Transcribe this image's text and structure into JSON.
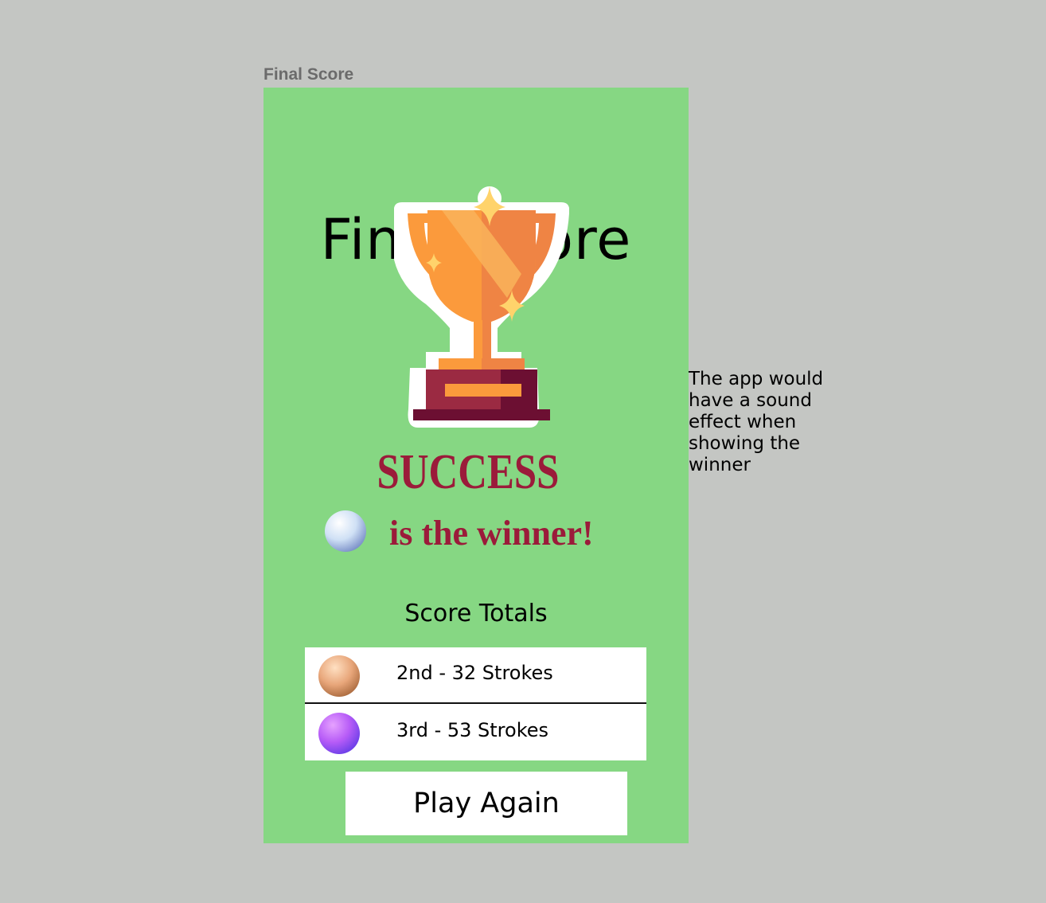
{
  "frame_label": "Final Score",
  "screen": {
    "title": "Final Score",
    "winner_name": "SUCCESS",
    "winner_text": "is the winner!",
    "score_totals_title": "Score Totals",
    "scores": [
      {
        "text": "2nd - 32 Strokes",
        "ball_color": "#e8a67a"
      },
      {
        "text": "3rd - 53 Strokes",
        "ball_color": "#9a55ff"
      }
    ],
    "play_again_label": "Play Again"
  },
  "annotation": "The app would have a sound effect when showing the winner",
  "icons": {
    "trophy": "trophy-icon",
    "winner_ball": "golf-ball-icon"
  },
  "colors": {
    "background": "#c4c6c3",
    "screen": "#86d783",
    "winner": "#9b1b3a",
    "trophy_orange": "#fb9a3c",
    "trophy_base": "#8a1c3b"
  }
}
